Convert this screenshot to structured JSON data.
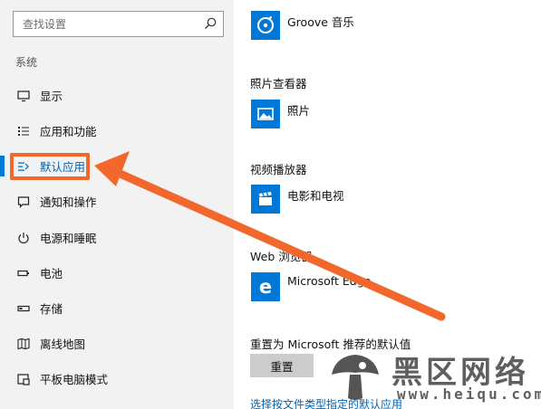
{
  "sidebar": {
    "search": {
      "placeholder": "查找设置",
      "value": ""
    },
    "section_title": "系统",
    "items": [
      {
        "label": "显示",
        "icon": "monitor-icon"
      },
      {
        "label": "应用和功能",
        "icon": "list-icon"
      },
      {
        "label": "默认应用",
        "icon": "default-apps-icon",
        "selected": true
      },
      {
        "label": "通知和操作",
        "icon": "notification-icon"
      },
      {
        "label": "电源和睡眠",
        "icon": "power-icon"
      },
      {
        "label": "电池",
        "icon": "battery-icon"
      },
      {
        "label": "存储",
        "icon": "storage-icon"
      },
      {
        "label": "离线地图",
        "icon": "map-icon"
      },
      {
        "label": "平板电脑模式",
        "icon": "tablet-icon"
      }
    ]
  },
  "main": {
    "music": {
      "app": "Groove 音乐",
      "icon": "groove-icon"
    },
    "photo": {
      "category": "照片查看器",
      "app": "照片",
      "icon": "photos-icon"
    },
    "video": {
      "category": "视频播放器",
      "app": "电影和电视",
      "icon": "film-icon"
    },
    "browser": {
      "category": "Web 浏览器",
      "app": "Microsoft Edge",
      "icon": "edge-icon"
    },
    "reset": {
      "title": "重置为 Microsoft 推荐的默认值",
      "button": "重置"
    },
    "link": "选择按文件类型指定的默认应用"
  },
  "colors": {
    "accent": "#0078d7",
    "annotation": "#f2672b",
    "sidebar_bg": "#f2f2f2"
  },
  "watermark": {
    "title": "黑区网络",
    "url": "www.heiqu.com"
  }
}
